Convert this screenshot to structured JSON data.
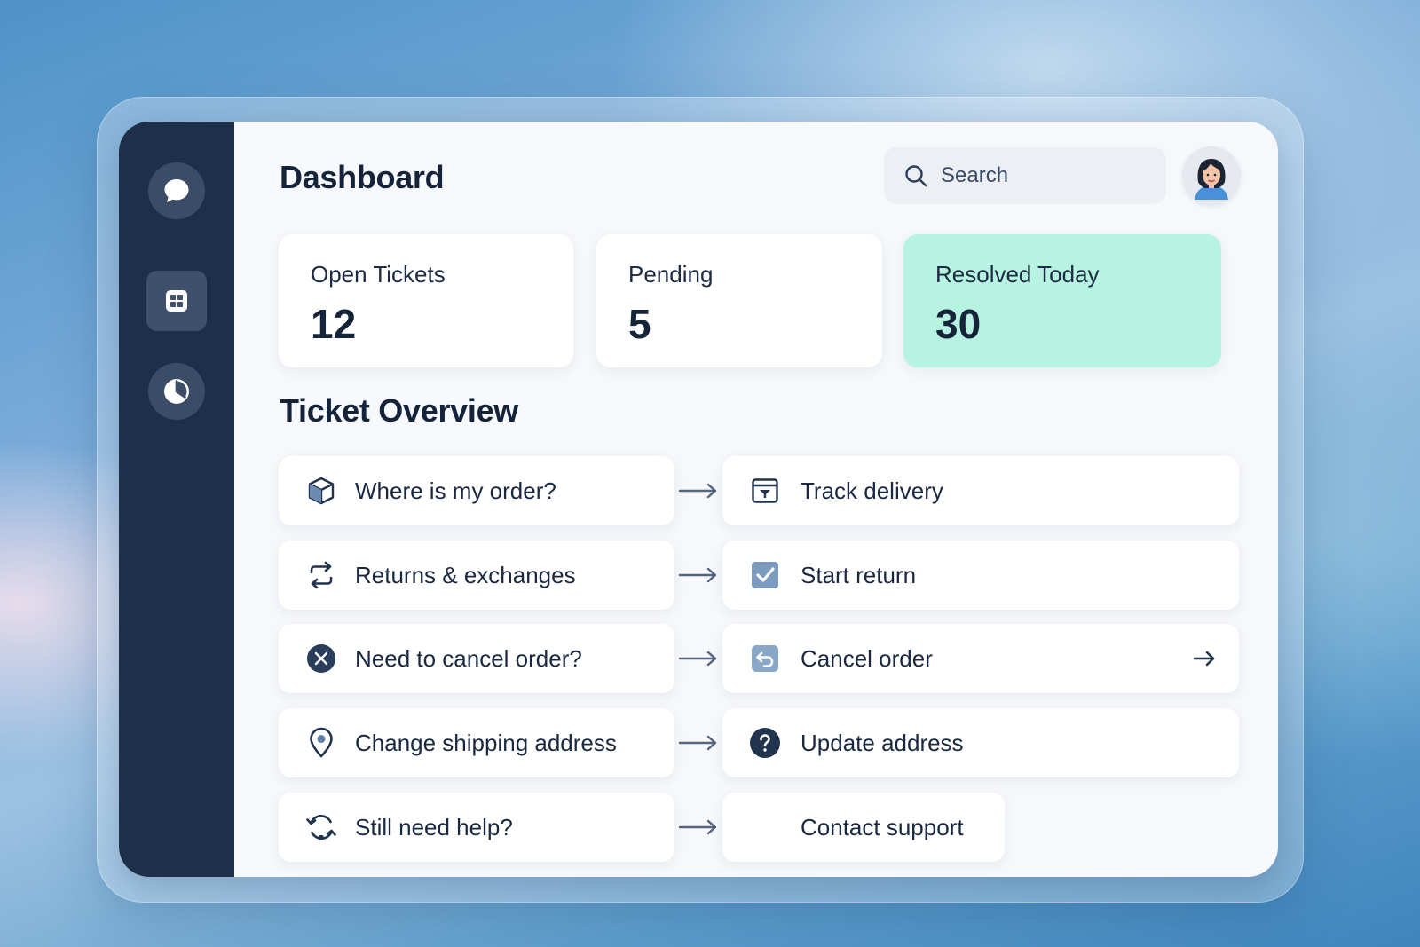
{
  "header": {
    "title": "Dashboard",
    "search_placeholder": "Search"
  },
  "sidebar": {
    "items": [
      {
        "name": "chat",
        "icon": "chat-bubble-icon",
        "active": false
      },
      {
        "name": "dashboard",
        "icon": "grid-icon",
        "active": true
      },
      {
        "name": "reports",
        "icon": "pie-chart-icon",
        "active": false
      }
    ]
  },
  "stats": [
    {
      "label": "Open Tickets",
      "value": "12"
    },
    {
      "label": "Pending",
      "value": "5"
    },
    {
      "label": "Resolved Today",
      "value": "30",
      "accent": "#b6f4e1"
    }
  ],
  "overview": {
    "title": "Ticket Overview",
    "rows": [
      {
        "question": "Where is my order?",
        "question_icon": "package-icon",
        "action": "Track delivery",
        "action_icon": "calendar-icon"
      },
      {
        "question": "Returns & exchanges",
        "question_icon": "refresh-icon",
        "action": "Start return",
        "action_icon": "checkbox-icon"
      },
      {
        "question": "Need to cancel order?",
        "question_icon": "x-circle-icon",
        "action": "Cancel order",
        "action_icon": "undo-icon"
      },
      {
        "question": "Change shipping address",
        "question_icon": "map-pin-icon",
        "action": "Update address",
        "action_icon": "help-circle-icon"
      },
      {
        "question": "Still need help?",
        "question_icon": "headset-refresh-icon",
        "action": "Contact support",
        "action_icon": ""
      }
    ]
  },
  "colors": {
    "sidebar": "#1e2f4a",
    "accent_card": "#b6f4e1",
    "text": "#15233a"
  }
}
